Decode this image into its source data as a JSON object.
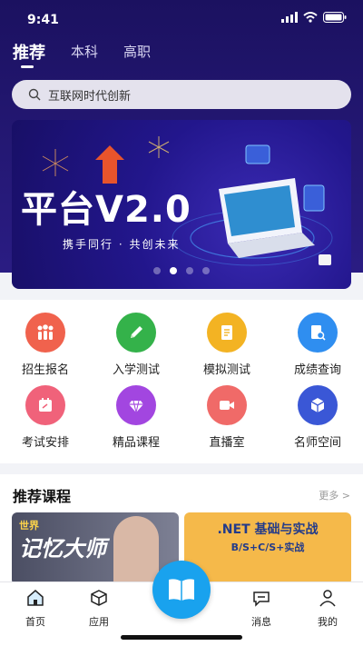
{
  "status_bar": {
    "time": "9:41"
  },
  "tabs": [
    {
      "label": "推荐"
    },
    {
      "label": "本科"
    },
    {
      "label": "高职"
    }
  ],
  "search": {
    "placeholder": "互联网时代创新"
  },
  "banner": {
    "title": "平台V2.0",
    "subtitle": "携手同行 · 共创未来",
    "page_count": 4,
    "active_page": 2
  },
  "features": [
    {
      "label": "招生报名",
      "icon": "people-icon",
      "color": "#f0624d"
    },
    {
      "label": "入学测试",
      "icon": "pencil-icon",
      "color": "#34b24a"
    },
    {
      "label": "模拟测试",
      "icon": "document-icon",
      "color": "#f3b323"
    },
    {
      "label": "成绩查询",
      "icon": "search-doc-icon",
      "color": "#2f8ef0"
    },
    {
      "label": "考试安排",
      "icon": "calendar-icon",
      "color": "#f0627a"
    },
    {
      "label": "精品课程",
      "icon": "diamond-icon",
      "color": "#a246e0"
    },
    {
      "label": "直播室",
      "icon": "video-icon",
      "color": "#f06a68"
    },
    {
      "label": "名师空间",
      "icon": "cube-icon",
      "color": "#3a57d6"
    }
  ],
  "recommended": {
    "title": "推荐课程",
    "more": "更多",
    "cards": [
      {
        "title_small": "世界",
        "title": "记忆大师"
      },
      {
        "title": ".NET 基础与实战",
        "subtitle": "B/S+C/S+实战"
      }
    ]
  },
  "bottom_nav": [
    {
      "label": "首页",
      "icon": "home-icon"
    },
    {
      "label": "应用",
      "icon": "box-icon"
    },
    {
      "label": "消息",
      "icon": "message-icon"
    },
    {
      "label": "我的",
      "icon": "user-icon"
    }
  ],
  "center_action": {
    "icon": "book-icon"
  },
  "colors": {
    "header_bg": "#1b1160",
    "accent": "#19a2ee"
  }
}
